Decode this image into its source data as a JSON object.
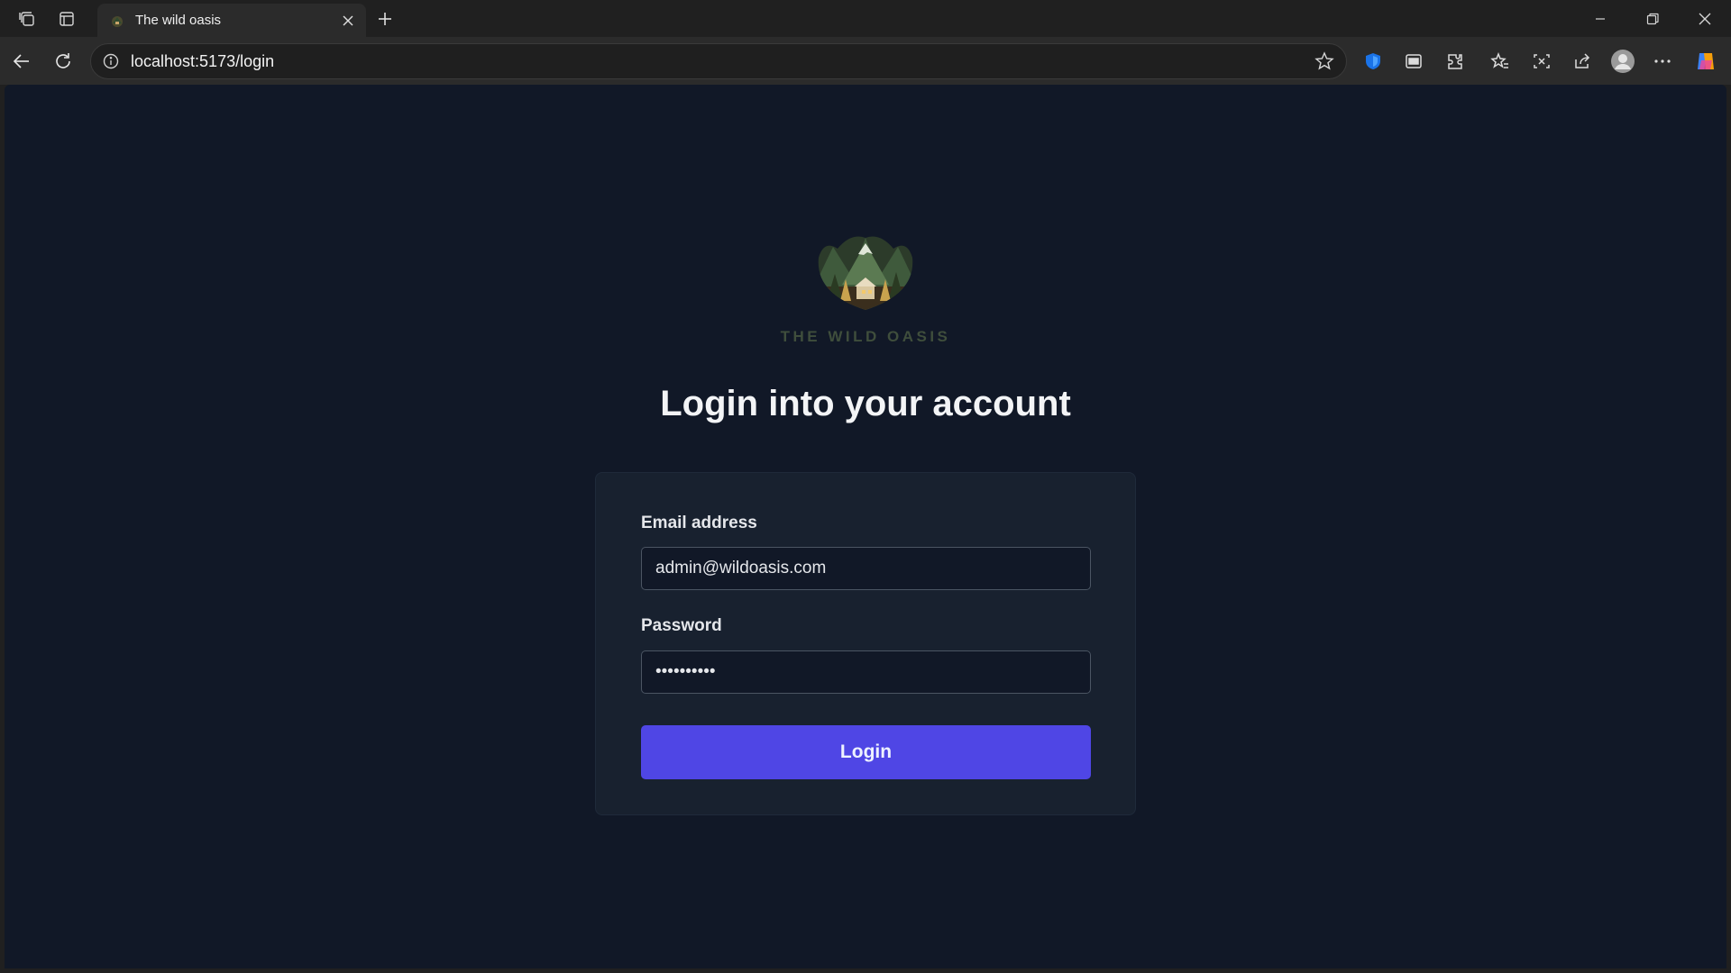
{
  "browser": {
    "tab_title": "The wild oasis",
    "url": "localhost:5173/login"
  },
  "page": {
    "brand_name": "THE WILD OASIS",
    "heading": "Login into your account",
    "email_label": "Email address",
    "email_value": "admin@wildoasis.com",
    "password_label": "Password",
    "password_value": "••••••••••",
    "login_button": "Login"
  },
  "colors": {
    "page_bg": "#111827",
    "card_bg": "#18212f",
    "button_bg": "#4f46e5",
    "brand_text": "#3f4e3c"
  }
}
